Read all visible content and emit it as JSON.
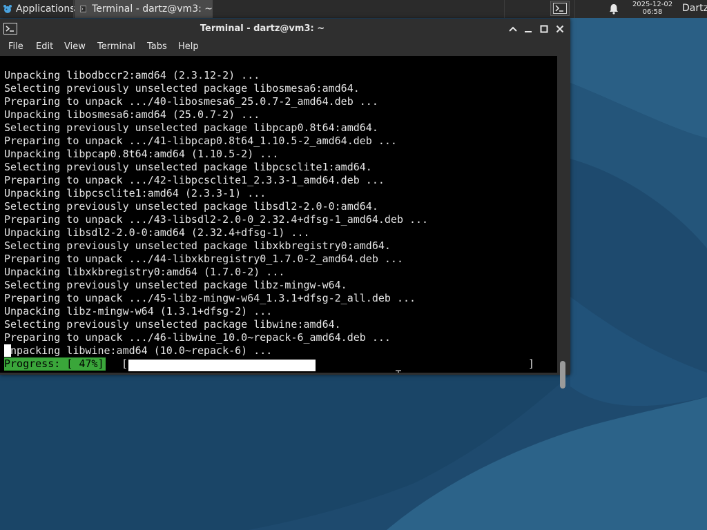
{
  "panel": {
    "applications_label": "Applications",
    "task_label": "Terminal - dartz@vm3: ~",
    "clock_date": "2025-12-02",
    "clock_time": "06:58",
    "user_label": "Dartz"
  },
  "window": {
    "title": "Terminal - dartz@vm3: ~"
  },
  "menu": {
    "items": [
      "File",
      "Edit",
      "View",
      "Terminal",
      "Tabs",
      "Help"
    ]
  },
  "terminal": {
    "lines": [
      "Unpacking libodbccr2:amd64 (2.3.12-2) ...",
      "Selecting previously unselected package libosmesa6:amd64.",
      "Preparing to unpack .../40-libosmesa6_25.0.7-2_amd64.deb ...",
      "Unpacking libosmesa6:amd64 (25.0.7-2) ...",
      "Selecting previously unselected package libpcap0.8t64:amd64.",
      "Preparing to unpack .../41-libpcap0.8t64_1.10.5-2_amd64.deb ...",
      "Unpacking libpcap0.8t64:amd64 (1.10.5-2) ...",
      "Selecting previously unselected package libpcsclite1:amd64.",
      "Preparing to unpack .../42-libpcsclite1_2.3.3-1_amd64.deb ...",
      "Unpacking libpcsclite1:amd64 (2.3.3-1) ...",
      "Selecting previously unselected package libsdl2-2.0-0:amd64.",
      "Preparing to unpack .../43-libsdl2-2.0-0_2.32.4+dfsg-1_amd64.deb ...",
      "Unpacking libsdl2-2.0-0:amd64 (2.32.4+dfsg-1) ...",
      "Selecting previously unselected package libxkbregistry0:amd64.",
      "Preparing to unpack .../44-libxkbregistry0_1.7.0-2_amd64.deb ...",
      "Unpacking libxkbregistry0:amd64 (1.7.0-2) ...",
      "Selecting previously unselected package libz-mingw-w64.",
      "Preparing to unpack .../45-libz-mingw-w64_1.3.1+dfsg-2_all.deb ...",
      "Unpacking libz-mingw-w64 (1.3.1+dfsg-2) ...",
      "Selecting previously unselected package libwine:amd64.",
      "Preparing to unpack .../46-libwine_10.0~repack-6_amd64.deb ...",
      "Unpacking libwine:amd64 (10.0~repack-6) ..."
    ],
    "progress_label": "Progress: [ 47%]",
    "progress_open": "[",
    "progress_close": "]",
    "progress_fraction": 0.47
  },
  "icons": {
    "apps": "xfce-mouse-icon",
    "task": "terminal-icon",
    "tray": "terminal-icon",
    "notify": "bell-icon",
    "minimize": "minimize-icon",
    "maximize": "maximize-icon",
    "close": "close-icon",
    "up": "chevron-up-icon"
  },
  "colors": {
    "progress_label_bg": "#3aa63a",
    "progress_fill": "#ffffff",
    "terminal_bg": "#000000",
    "desktop": "#1f4a6d"
  }
}
